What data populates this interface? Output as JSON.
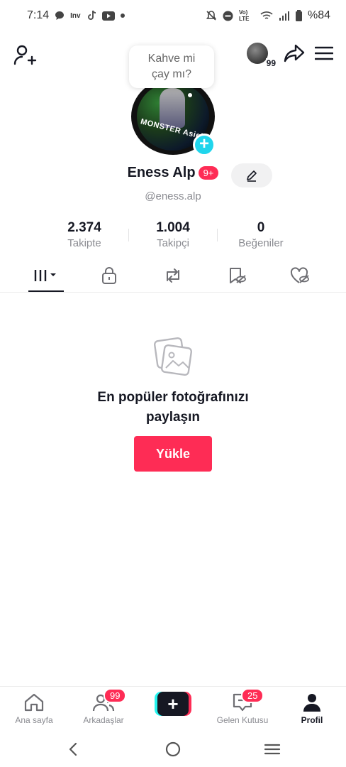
{
  "status_bar": {
    "time": "7:14",
    "net_badge": "Vo) LTE",
    "battery": "%84",
    "icons_left": [
      "chat-bubble-icon",
      "inv-icon",
      "tiktok-icon",
      "youtube-icon",
      "dot-icon"
    ],
    "icons_right": [
      "mute-icon",
      "dnd-icon",
      "volte-icon",
      "wifi-icon",
      "signal-icon",
      "battery-icon"
    ]
  },
  "header": {
    "story_count": "99",
    "bubble_text_line1": "Kahve mi",
    "bubble_text_line2": "çay mı?"
  },
  "profile": {
    "display_name": "Eness Alp",
    "badge": "9+",
    "username": "@eness.alp",
    "avatar_caption": "MONSTER Asiel"
  },
  "stats": [
    {
      "number": "2.374",
      "label": "Takipte"
    },
    {
      "number": "1.004",
      "label": "Takipçi"
    },
    {
      "number": "0",
      "label": "Beğeniler"
    }
  ],
  "tabs": [
    "grid-icon",
    "lock-icon",
    "repost-icon",
    "bookmark-hidden-icon",
    "liked-hidden-icon"
  ],
  "empty_state": {
    "title_line1": "En popüler fotoğrafınızı",
    "title_line2": "paylaşın",
    "button": "Yükle"
  },
  "bottom_nav": {
    "home": "Ana sayfa",
    "friends": "Arkadaşlar",
    "friends_badge": "99",
    "create": "+",
    "inbox": "Gelen Kutusu",
    "inbox_badge": "25",
    "profile": "Profil"
  },
  "colors": {
    "accent": "#fe2c55",
    "cyan": "#25f4ee",
    "text": "#161823",
    "muted": "#8a8b91"
  }
}
